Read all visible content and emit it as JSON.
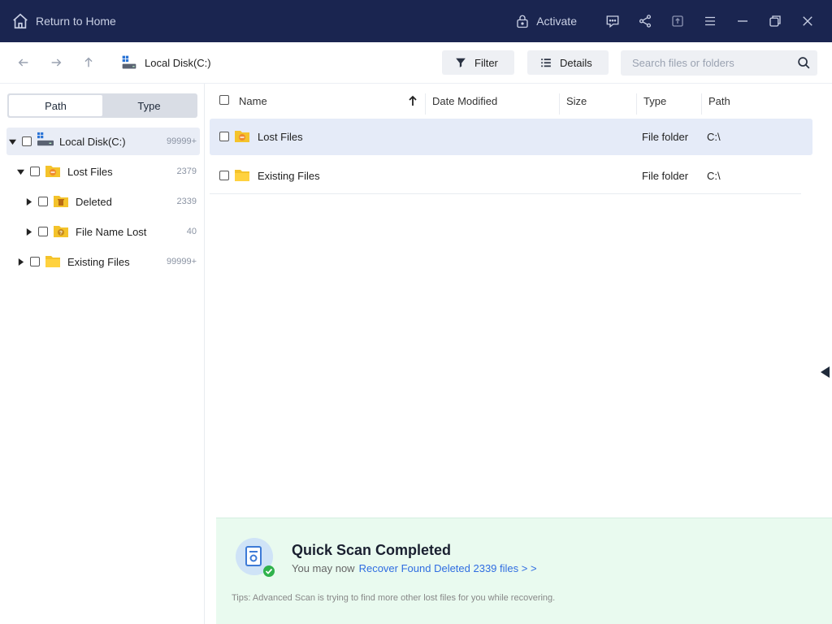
{
  "titlebar": {
    "home_label": "Return to Home",
    "activate_label": "Activate",
    "icons": [
      "feedback-icon",
      "share-icon",
      "export-icon",
      "menu-icon",
      "minimize-icon",
      "restore-icon",
      "close-icon"
    ],
    "bg_color": "#1a2550"
  },
  "toolbar": {
    "breadcrumb": "Local Disk(C:)",
    "filter_label": "Filter",
    "details_label": "Details",
    "search_placeholder": "Search files or folders"
  },
  "sidebar": {
    "tabs": [
      "Path",
      "Type"
    ],
    "active_tab": "Path",
    "tree": [
      {
        "label": "Local Disk(C:)",
        "count": "99999+",
        "expanded": true
      },
      {
        "label": "Lost Files",
        "count": "2379",
        "expanded": true
      },
      {
        "label": "Deleted",
        "count": "2339",
        "expanded": false
      },
      {
        "label": "File Name Lost",
        "count": "40",
        "expanded": false
      },
      {
        "label": "Existing Files",
        "count": "99999+",
        "expanded": false
      }
    ]
  },
  "table": {
    "columns": [
      "Name",
      "Date Modified",
      "Size",
      "Type",
      "Path"
    ],
    "sort_column": "Name",
    "rows": [
      {
        "name": "Lost Files",
        "date": "",
        "size": "",
        "type": "File folder",
        "path": "C:\\"
      },
      {
        "name": "Existing Files",
        "date": "",
        "size": "",
        "type": "File folder",
        "path": "C:\\"
      }
    ]
  },
  "banner": {
    "title": "Quick Scan Completed",
    "sub_prefix": "You may now",
    "link": "Recover Found Deleted 2339 files > >",
    "tip": "Tips: Advanced Scan is trying to find more other lost files for you while recovering.",
    "bg_color": "#e9faef",
    "link_color": "#2f6de1"
  }
}
